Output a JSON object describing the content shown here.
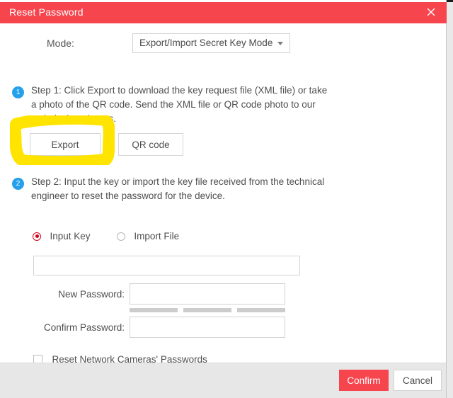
{
  "window": {
    "title": "Reset Password",
    "close_icon": "close-icon",
    "title_bar_color": "#f7454e"
  },
  "mode": {
    "label": "Mode:",
    "selected": "Export/Import Secret Key Mode",
    "dropdown_icon": "chevron-down-icon",
    "options": [
      "Export/Import Secret Key Mode"
    ]
  },
  "step1": {
    "badge": "1",
    "text": "Step 1: Click Export to download the key request file (XML file) or take a photo of the QR code. Send the XML file or QR code photo to our technical engineers.",
    "export_button": "Export",
    "qrcode_button": "QR code"
  },
  "annotation": {
    "kind": "hand-drawn-highlight-rectangle",
    "color": "#ffe400",
    "targets": "Export"
  },
  "step2": {
    "badge": "2",
    "text": "Step 2: Input the key or import the key file received from the technical engineer to reset the password for the device."
  },
  "source_choice": {
    "options": [
      {
        "label": "Input Key",
        "checked": true
      },
      {
        "label": "Import File",
        "checked": false
      }
    ],
    "accent_color": "#d0021b"
  },
  "fields": {
    "key": {
      "value": "",
      "placeholder": ""
    },
    "new_password": {
      "label": "New Password:",
      "value": "",
      "placeholder": ""
    },
    "confirm_password": {
      "label": "Confirm Password:",
      "value": "",
      "placeholder": ""
    }
  },
  "strength_meter": {
    "segments": 3,
    "filled": 0,
    "empty_color": "#cccccc"
  },
  "reset_cameras": {
    "label": "Reset Network Cameras' Passwords",
    "checked": false
  },
  "footer": {
    "confirm_label": "Confirm",
    "cancel_label": "Cancel",
    "confirm_color": "#f7454e"
  }
}
